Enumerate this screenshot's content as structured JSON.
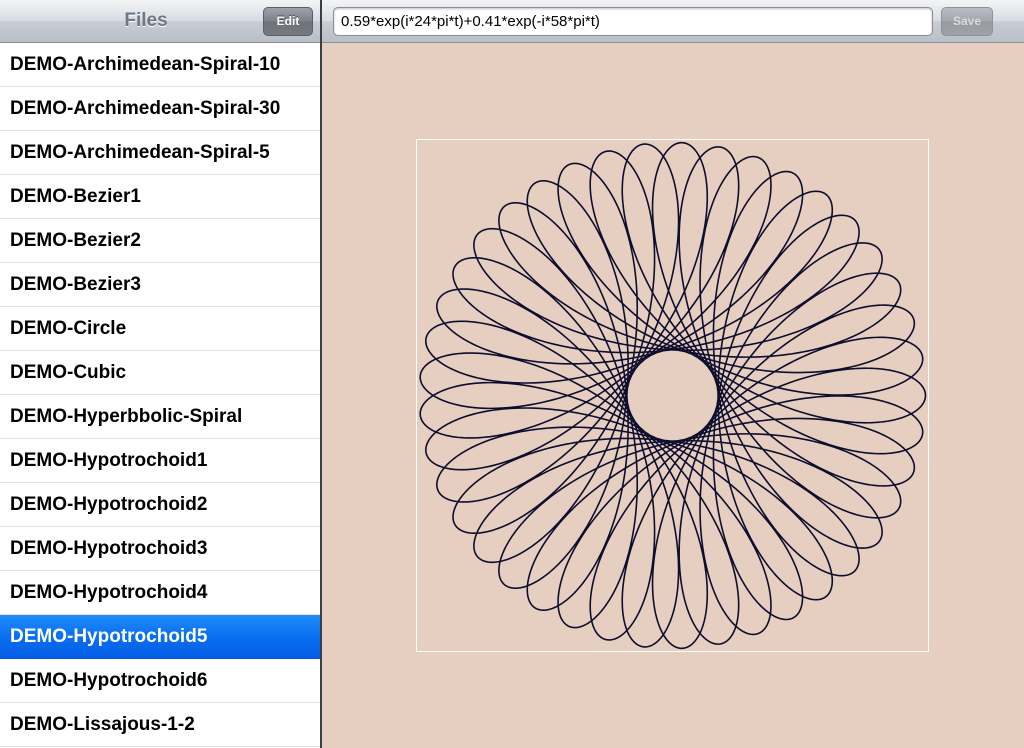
{
  "sidebar": {
    "title": "Files",
    "edit_label": "Edit",
    "items": [
      {
        "label": "DEMO-Archimedean-Spiral-10",
        "selected": false
      },
      {
        "label": "DEMO-Archimedean-Spiral-30",
        "selected": false
      },
      {
        "label": "DEMO-Archimedean-Spiral-5",
        "selected": false
      },
      {
        "label": "DEMO-Bezier1",
        "selected": false
      },
      {
        "label": "DEMO-Bezier2",
        "selected": false
      },
      {
        "label": "DEMO-Bezier3",
        "selected": false
      },
      {
        "label": "DEMO-Circle",
        "selected": false
      },
      {
        "label": "DEMO-Cubic",
        "selected": false
      },
      {
        "label": "DEMO-Hyperbbolic-Spiral",
        "selected": false
      },
      {
        "label": "DEMO-Hypotrochoid1",
        "selected": false
      },
      {
        "label": "DEMO-Hypotrochoid2",
        "selected": false
      },
      {
        "label": "DEMO-Hypotrochoid3",
        "selected": false
      },
      {
        "label": "DEMO-Hypotrochoid4",
        "selected": false
      },
      {
        "label": "DEMO-Hypotrochoid5",
        "selected": true
      },
      {
        "label": "DEMO-Hypotrochoid6",
        "selected": false
      },
      {
        "label": "DEMO-Lissajous-1-2",
        "selected": false
      }
    ]
  },
  "editor": {
    "formula": "0.59*exp(i*24*pi*t)+0.41*exp(-i*58*pi*t)",
    "save_label": "Save",
    "save_enabled": false
  },
  "plot": {
    "terms": [
      {
        "amplitude": 0.59,
        "frequency": 24
      },
      {
        "amplitude": 0.41,
        "frequency": -58
      }
    ],
    "t_range": [
      0,
      1
    ],
    "curve_color": "#0d0d2e",
    "background_color": "#e6cfc0",
    "frame_color": "#ffffff"
  }
}
